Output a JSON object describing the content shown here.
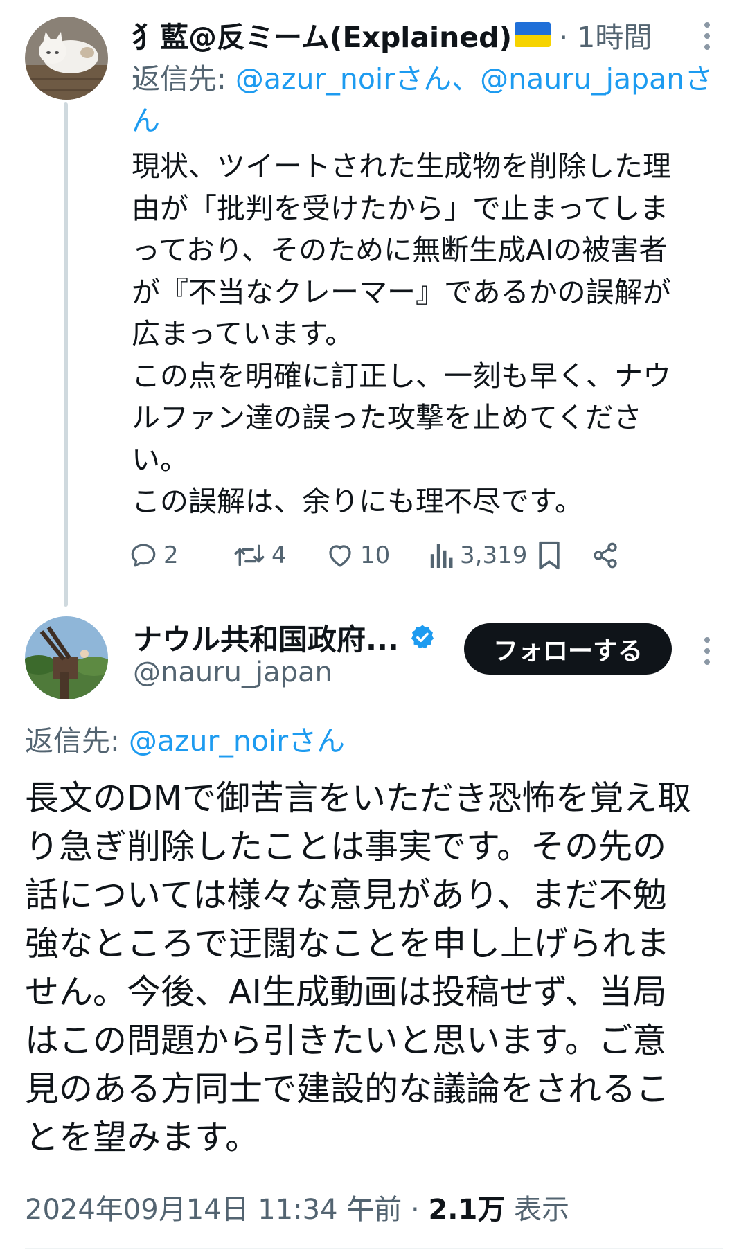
{
  "tweet1": {
    "author_name": "犭藍@反ミーム(Explained)",
    "time": "· 1時間",
    "reply_label": "返信先: ",
    "reply_mentions": "@azur_noirさん、@nauru_japanさん",
    "body": "現状、ツイートされた生成物を削除した理\n由が「批判を受けたから」で止まってしま\nっており、そのために無断生成AIの被害者\nが『不当なクレーマー』であるかの誤解が\n広まっています。\nこの点を明確に訂正し、一刻も早く、ナウ\nルファン達の誤った攻撃を止めてくださ\nい。\nこの誤解は、余りにも理不尽です。",
    "actions": {
      "replies": "2",
      "retweets": "4",
      "likes": "10",
      "views": "3,319"
    }
  },
  "tweet2": {
    "author_name": "ナウル共和国政府...",
    "handle": "@nauru_japan",
    "follow_label": "フォローする",
    "reply_label": "返信先: ",
    "reply_mention": "@azur_noirさん",
    "body": "長文のDMで御苦言をいただき恐怖を覚え取\nり急ぎ削除したことは事実です。その先の\n話については様々な意見があり、まだ不勉\n強なところで迂闊なことを申し上げられま\nせん。今後、AI生成動画は投稿せず、当局\nはこの問題から引きたいと思います。ご意\n見のある方同士で建設的な議論をされるこ\nとを望みます。",
    "date": "2024年09月14日 11:34 午前",
    "separator": " · ",
    "views_count": "2.1万",
    "views_label": " 表示"
  },
  "colors": {
    "text": "#0f1419",
    "secondary": "#536471",
    "link": "#1d9bf0",
    "verified": "#1d9bf0",
    "follow_bg": "#0f1419"
  },
  "icons": {
    "tweet1_avatar": "cat-avatar",
    "tweet2_avatar": "anti-aircraft-gun-avatar",
    "flag": "ukraine-flag-icon",
    "verified": "verified-badge-icon"
  }
}
